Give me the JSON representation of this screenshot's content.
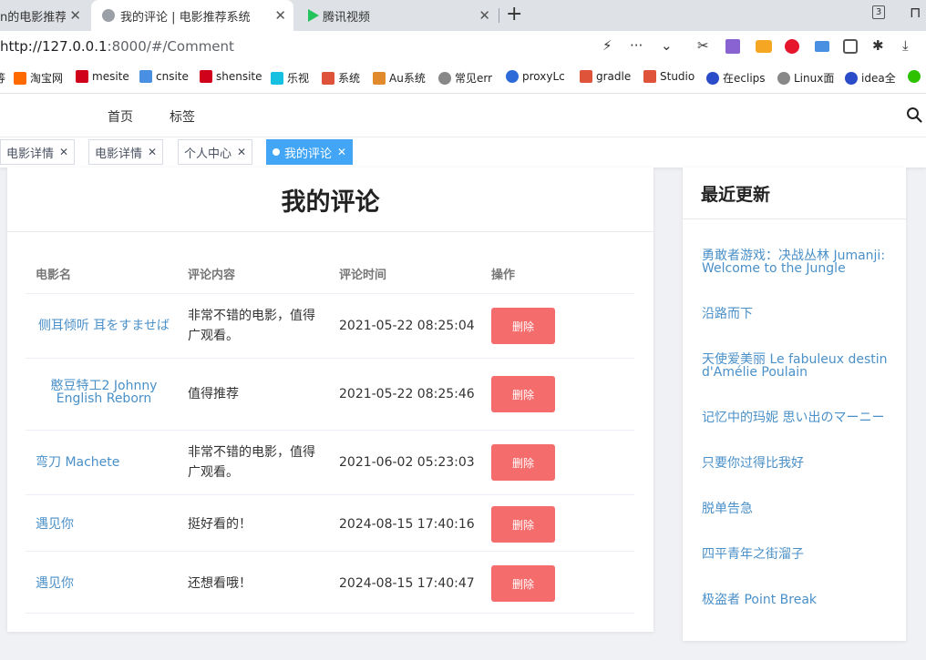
{
  "browser": {
    "tabs": [
      {
        "title": "n的电影推荐"
      },
      {
        "title": "我的评论 | 电影推荐系统"
      },
      {
        "title": "腾讯视频"
      }
    ],
    "tab_count": "3",
    "url_host": "http://127.0.0.1",
    "url_rest": ":8000/#/Comment",
    "bookmarks": [
      {
        "label": "淘宝网",
        "color": "#ff6a00"
      },
      {
        "label": "mesite",
        "color": "#d0021b"
      },
      {
        "label": "cnsite",
        "color": "#4a90e2"
      },
      {
        "label": "shensite",
        "color": "#d0021b"
      },
      {
        "label": "乐视",
        "color": "#16c0e0"
      },
      {
        "label": "系统",
        "color": "#e0533b"
      },
      {
        "label": "Au系统",
        "color": "#e08a2b"
      },
      {
        "label": "常见err",
        "color": "#888888"
      },
      {
        "label": "proxyLc",
        "color": "#2f6bd8"
      },
      {
        "label": "gradle",
        "color": "#e0533b"
      },
      {
        "label": "Studio",
        "color": "#e0533b"
      },
      {
        "label": "在eclips",
        "color": "#2a4cc8"
      },
      {
        "label": "Linux面",
        "color": "#888888"
      },
      {
        "label": "idea全",
        "color": "#2a4cc8"
      }
    ]
  },
  "header": {
    "nav": [
      "首页",
      "标签"
    ]
  },
  "page_tabs": [
    {
      "label": "电影详情"
    },
    {
      "label": "电影详情"
    },
    {
      "label": "个人中心"
    },
    {
      "label": "我的评论"
    }
  ],
  "main": {
    "title": "我的评论",
    "columns": [
      "电影名",
      "评论内容",
      "评论时间",
      "操作"
    ],
    "delete_label": "删除",
    "rows": [
      {
        "movie": "侧耳倾听 耳をすませば",
        "comment": "非常不错的电影，值得广观看。",
        "time": "2021-05-22 08:25:04"
      },
      {
        "movie": "憨豆特工2 Johnny English Reborn",
        "comment": "值得推荐",
        "time": "2021-05-22 08:25:46"
      },
      {
        "movie": "弯刀 Machete",
        "comment": "非常不错的电影，值得广观看。",
        "time": "2021-06-02 05:23:03"
      },
      {
        "movie": "遇见你",
        "comment": "挺好看的！",
        "time": "2024-08-15 17:40:16"
      },
      {
        "movie": "遇见你",
        "comment": "还想看哦！",
        "time": "2024-08-15 17:40:47"
      }
    ]
  },
  "sidebar": {
    "title": "最近更新",
    "items": [
      "勇敢者游戏：决战丛林 Jumanji: Welcome to the Jungle",
      "沿路而下",
      "天使爱美丽 Le fabuleux destin d'Amélie Poulain",
      "记忆中的玛妮 思い出のマーニー",
      "只要你过得比我好",
      "脱单告急",
      "四平青年之街溜子",
      "极盗者 Point Break"
    ]
  },
  "colors": {
    "delete_button": "#f56c6c",
    "link": "#4a90c8",
    "active_tab": "#42a5f5"
  }
}
